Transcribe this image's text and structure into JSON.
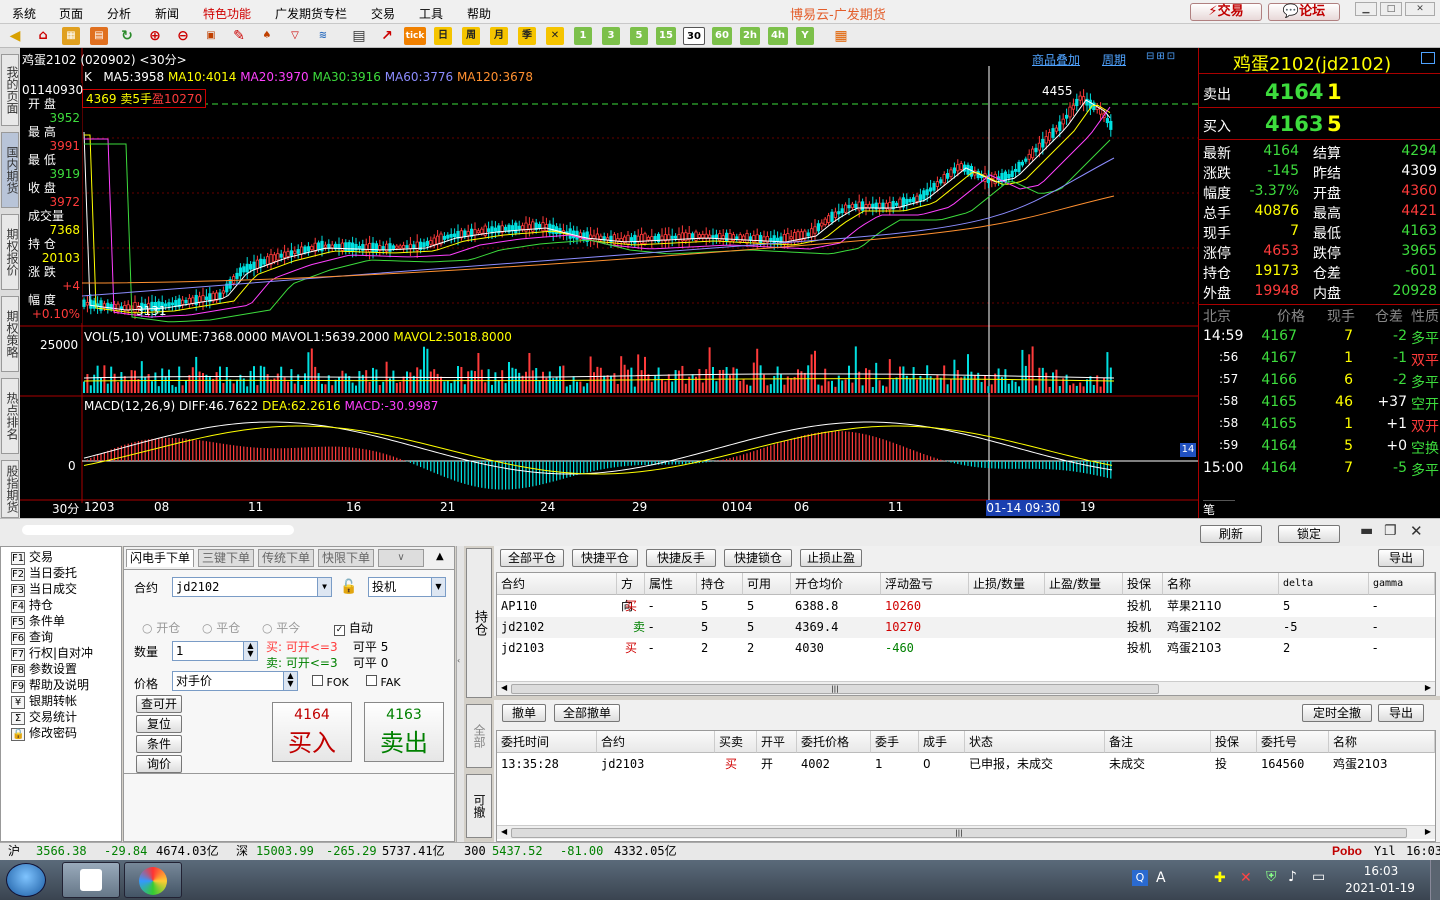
{
  "menu": [
    "系统",
    "页面",
    "分析",
    "新闻",
    "特色功能",
    "广发期货专栏",
    "交易",
    "工具",
    "帮助"
  ],
  "app_title": "博易云-广发期货",
  "top_buttons": {
    "trade": "交易",
    "forum": "论坛"
  },
  "toolbar": {
    "daily": "日",
    "weekly": "周",
    "monthly": "月",
    "quarterly": "季",
    "tick": "tick",
    "periods": [
      "1",
      "3",
      "5",
      "15",
      "30",
      "60",
      "2h",
      "4h",
      "Y"
    ]
  },
  "side_tabs": [
    "我的页面",
    "国内期货",
    "期权报价",
    "期权策略",
    "热点排名",
    "股指期货"
  ],
  "chart": {
    "header_left": "鸡蛋2102 (020902) <30分>",
    "links": [
      "商品叠加",
      "周期"
    ],
    "ma_line": {
      "k": "K",
      "ma5": "MA5:3958",
      "ma10": "MA10:4014",
      "ma20": "MA20:3970",
      "ma30": "MA30:3916",
      "ma60": "MA60:3776",
      "ma120": "MA120:3678"
    },
    "position_tag": {
      "price": "4369",
      "dir": "卖5手",
      "pnl_label": "盈",
      "pnl": "10270"
    },
    "peak_label": "4455",
    "low_label": "3131",
    "vol_header": {
      "name": "VOL(5,10)",
      "volume": "VOLUME:7368.0000",
      "mavol1": "MAVOL1:5639.2000",
      "mavol2": "MAVOL2:5018.8000"
    },
    "vol_axis": "25000",
    "macd_header": {
      "name": "MACD(12,26,9)",
      "diff": "DIFF:46.7622",
      "dea": "DEA:62.2616",
      "macd": "MACD:-30.9987"
    },
    "macd_axis": "0",
    "macd_badge": "14",
    "period_label": "30分",
    "x_ticks": [
      "1203",
      "08",
      "11",
      "16",
      "21",
      "24",
      "29",
      "0104",
      "06",
      "11",
      "19"
    ],
    "crosshair_time": "01-14 09:30",
    "info_box": {
      "time": "01140930",
      "items": [
        {
          "label": "开 盘",
          "value": "3952",
          "color": "#3ddc3d"
        },
        {
          "label": "最 高",
          "value": "3991",
          "color": "#ff3b3b"
        },
        {
          "label": "最 低",
          "value": "3919",
          "color": "#3ddc3d"
        },
        {
          "label": "收 盘",
          "value": "3972",
          "color": "#ff3b3b"
        },
        {
          "label": "成交量",
          "value": "7368",
          "color": "#ffff00"
        },
        {
          "label": "持 仓",
          "value": "20103",
          "color": "#ffff00"
        },
        {
          "label": "涨 跌",
          "value": "+4",
          "color": "#ff3b3b"
        },
        {
          "label": "幅 度",
          "value": "+0.10%",
          "color": "#ff3b3b"
        }
      ]
    }
  },
  "quote": {
    "title": "鸡蛋2102(jd2102)",
    "sell": {
      "label": "卖出",
      "price": "4164",
      "qty": "1"
    },
    "buy": {
      "label": "买入",
      "price": "4163",
      "qty": "5"
    },
    "fields": [
      {
        "l1": "最新",
        "v1": "4164",
        "c1": "green",
        "l2": "结算",
        "v2": "4294",
        "c2": "green"
      },
      {
        "l1": "涨跌",
        "v1": "-145",
        "c1": "green",
        "l2": "昨结",
        "v2": "4309",
        "c2": "white"
      },
      {
        "l1": "幅度",
        "v1": "-3.37%",
        "c1": "green",
        "l2": "开盘",
        "v2": "4360",
        "c2": "red"
      },
      {
        "l1": "总手",
        "v1": "40876",
        "c1": "yellow",
        "l2": "最高",
        "v2": "4421",
        "c2": "red"
      },
      {
        "l1": "现手",
        "v1": "7",
        "c1": "yellow",
        "l2": "最低",
        "v2": "4163",
        "c2": "green"
      },
      {
        "l1": "涨停",
        "v1": "4653",
        "c1": "red",
        "l2": "跌停",
        "v2": "3965",
        "c2": "green"
      },
      {
        "l1": "持仓",
        "v1": "19173",
        "c1": "yellow",
        "l2": "仓差",
        "v2": "-601",
        "c2": "green"
      },
      {
        "l1": "外盘",
        "v1": "19948",
        "c1": "red",
        "l2": "内盘",
        "v2": "20928",
        "c2": "green"
      }
    ],
    "ticks_header": [
      "北京",
      "价格",
      "现手",
      "仓差",
      "性质"
    ],
    "ticks": [
      {
        "time": "14:59",
        "price": "4167",
        "vol": "7",
        "diff": "-2",
        "nature": "多平",
        "nc": "green",
        "dc": "green"
      },
      {
        "time": ":56",
        "price": "4167",
        "vol": "1",
        "diff": "-1",
        "nature": "双平",
        "nc": "red",
        "dc": "green"
      },
      {
        "time": ":57",
        "price": "4166",
        "vol": "6",
        "diff": "-2",
        "nature": "多平",
        "nc": "green",
        "dc": "green"
      },
      {
        "time": ":58",
        "price": "4165",
        "vol": "46",
        "diff": "+37",
        "nature": "空开",
        "nc": "green",
        "dc": "white"
      },
      {
        "time": ":58",
        "price": "4165",
        "vol": "1",
        "diff": "+1",
        "nature": "双开",
        "nc": "red",
        "dc": "white"
      },
      {
        "time": ":59",
        "price": "4164",
        "vol": "5",
        "diff": "+0",
        "nature": "空换",
        "nc": "green",
        "dc": "white"
      },
      {
        "time": "15:00",
        "price": "4164",
        "vol": "7",
        "diff": "-5",
        "nature": "多平",
        "nc": "green",
        "dc": "green"
      }
    ],
    "footer_tab": "笔"
  },
  "strip": {
    "refresh": "刷新",
    "lock": "锁定"
  },
  "nav": [
    {
      "key": "F1",
      "label": "交易"
    },
    {
      "key": "F2",
      "label": "当日委托"
    },
    {
      "key": "F3",
      "label": "当日成交"
    },
    {
      "key": "F4",
      "label": "持仓"
    },
    {
      "key": "F5",
      "label": "条件单"
    },
    {
      "key": "F6",
      "label": "查询"
    },
    {
      "key": "F7",
      "label": "行权|自对冲"
    },
    {
      "key": "F8",
      "label": "参数设置"
    },
    {
      "key": "F9",
      "label": "帮助及说明"
    },
    {
      "key": "¥",
      "label": "银期转帐"
    },
    {
      "key": "Σ",
      "label": "交易统计"
    },
    {
      "key": "🔒",
      "label": "修改密码"
    }
  ],
  "order": {
    "tabs": [
      "闪电手下单",
      "三键下单",
      "传统下单",
      "快限下单"
    ],
    "contract_label": "合约",
    "contract": "jd2102",
    "hedge": "投机",
    "open": "开仓",
    "close": "平仓",
    "close_today": "平今",
    "auto": "自动",
    "qty_label": "数量",
    "qty": "1",
    "buy_info": "买: 可开<=3",
    "sell_info": "卖: 可开<=3",
    "buy_close": "可平 5",
    "sell_close": "可平 0",
    "price_label": "价格",
    "price_mode": "对手价",
    "fok": "FOK",
    "fak": "FAK",
    "side_buttons": [
      "查可开",
      "复位",
      "条件",
      "询价"
    ],
    "buy_btn": {
      "price": "4164",
      "label": "买入"
    },
    "sell_btn": {
      "price": "4163",
      "label": "卖出"
    }
  },
  "vtabs": [
    "持仓",
    "全部",
    "可撤"
  ],
  "positions": {
    "buttons": [
      "全部平仓",
      "快捷平仓",
      "快捷反手",
      "快捷锁仓",
      "止损止盈"
    ],
    "export": "导出",
    "headers": [
      "合约",
      "方向",
      "属性",
      "持仓",
      "可用",
      "开仓均价",
      "浮动盈亏",
      "止损/数量",
      "止盈/数量",
      "投保",
      "名称",
      "delta",
      "gamma"
    ],
    "rows": [
      {
        "contract": "AP110",
        "dir": "买",
        "attr": "-",
        "pos": "5",
        "avail": "5",
        "avg": "6388.8",
        "pnl": "10260",
        "hedge": "投机",
        "name": "苹果2110",
        "delta": "5",
        "gamma": "-",
        "dc": "#d00000",
        "pc": "#d00000"
      },
      {
        "contract": "jd2102",
        "dir": "卖",
        "attr": "-",
        "pos": "5",
        "avail": "5",
        "avg": "4369.4",
        "pnl": "10270",
        "hedge": "投机",
        "name": "鸡蛋2102",
        "delta": "-5",
        "gamma": "-",
        "dc": "#008000",
        "pc": "#d00000"
      },
      {
        "contract": "jd2103",
        "dir": "买",
        "attr": "-",
        "pos": "2",
        "avail": "2",
        "avg": "4030",
        "pnl": "-460",
        "hedge": "投机",
        "name": "鸡蛋2103",
        "delta": "2",
        "gamma": "-",
        "dc": "#d00000",
        "pc": "#008000"
      }
    ]
  },
  "orders": {
    "buttons": [
      "撤单",
      "全部撤单"
    ],
    "right_buttons": [
      "定时全撤",
      "导出"
    ],
    "headers": [
      "委托时间",
      "合约",
      "买卖",
      "开平",
      "委托价格",
      "委手",
      "成手",
      "状态",
      "备注",
      "投保",
      "委托号",
      "名称"
    ],
    "rows": [
      {
        "time": "13:35:28",
        "contract": "jd2103",
        "side": "买",
        "oc": "开",
        "price": "4002",
        "qty": "1",
        "filled": "0",
        "status": "已申报，未成交",
        "note": "未成交",
        "hedge": "投",
        "no": "164560",
        "name": "鸡蛋2103"
      }
    ]
  },
  "status": {
    "sh_label": "沪",
    "sh_idx": "3566.38",
    "sh_chg": "-29.84",
    "sh_amt": "4674.03亿",
    "sz_label": "深",
    "sz_idx": "15003.99",
    "sz_chg": "-265.29",
    "sz_amt": "5737.41亿",
    "hs_label": "300",
    "hs_idx": "5437.52",
    "hs_chg": "-81.00",
    "hs_amt": "4332.05亿",
    "brand": "Pobo",
    "time": "16:03"
  },
  "taskbar": {
    "time": "16:03",
    "date": "2021-01-19"
  }
}
